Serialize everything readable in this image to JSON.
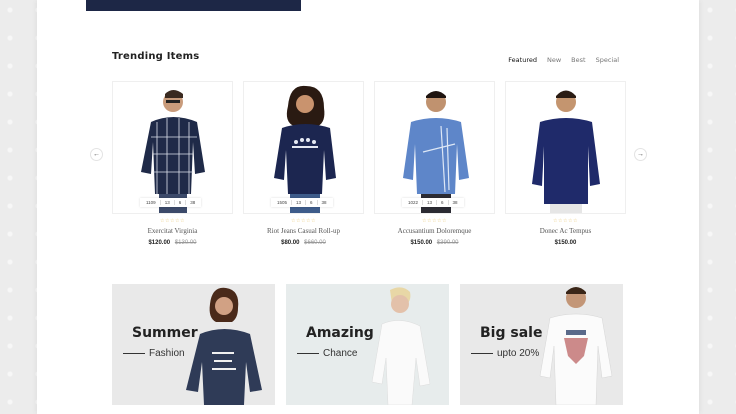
{
  "section": {
    "title": "Trending Items",
    "tabs": [
      "Featured",
      "New",
      "Best",
      "Special"
    ],
    "prev_arrow": "←",
    "next_arrow": "→"
  },
  "products": [
    {
      "name": "Exercitat Virginia",
      "price": "$120.00",
      "old_price": "$130.00",
      "countdown": [
        "1109",
        "13",
        "6",
        "38"
      ],
      "stars": "☆☆☆☆☆"
    },
    {
      "name": "Riot Jeans Casual Roll-up",
      "price": "$80.00",
      "old_price": "$660.00",
      "countdown": [
        "1505",
        "13",
        "6",
        "38"
      ],
      "stars": "☆☆☆☆☆"
    },
    {
      "name": "Accusantium Doloremque",
      "price": "$150.00",
      "old_price": "$390.00",
      "countdown": [
        "1022",
        "13",
        "6",
        "38"
      ],
      "stars": "☆☆☆☆☆"
    },
    {
      "name": "Donec Ac Tempus",
      "price": "$150.00",
      "old_price": "",
      "countdown": [],
      "stars": "☆☆☆☆☆"
    }
  ],
  "banners": [
    {
      "title": "Summer",
      "subtitle": "Fashion"
    },
    {
      "title": "Amazing",
      "subtitle": "Chance"
    },
    {
      "title": "Big sale",
      "subtitle": "upto 20%"
    }
  ],
  "colors": {
    "navy": "#1d2746",
    "star": "#e7c56a",
    "banner_bg": "#ececec"
  }
}
